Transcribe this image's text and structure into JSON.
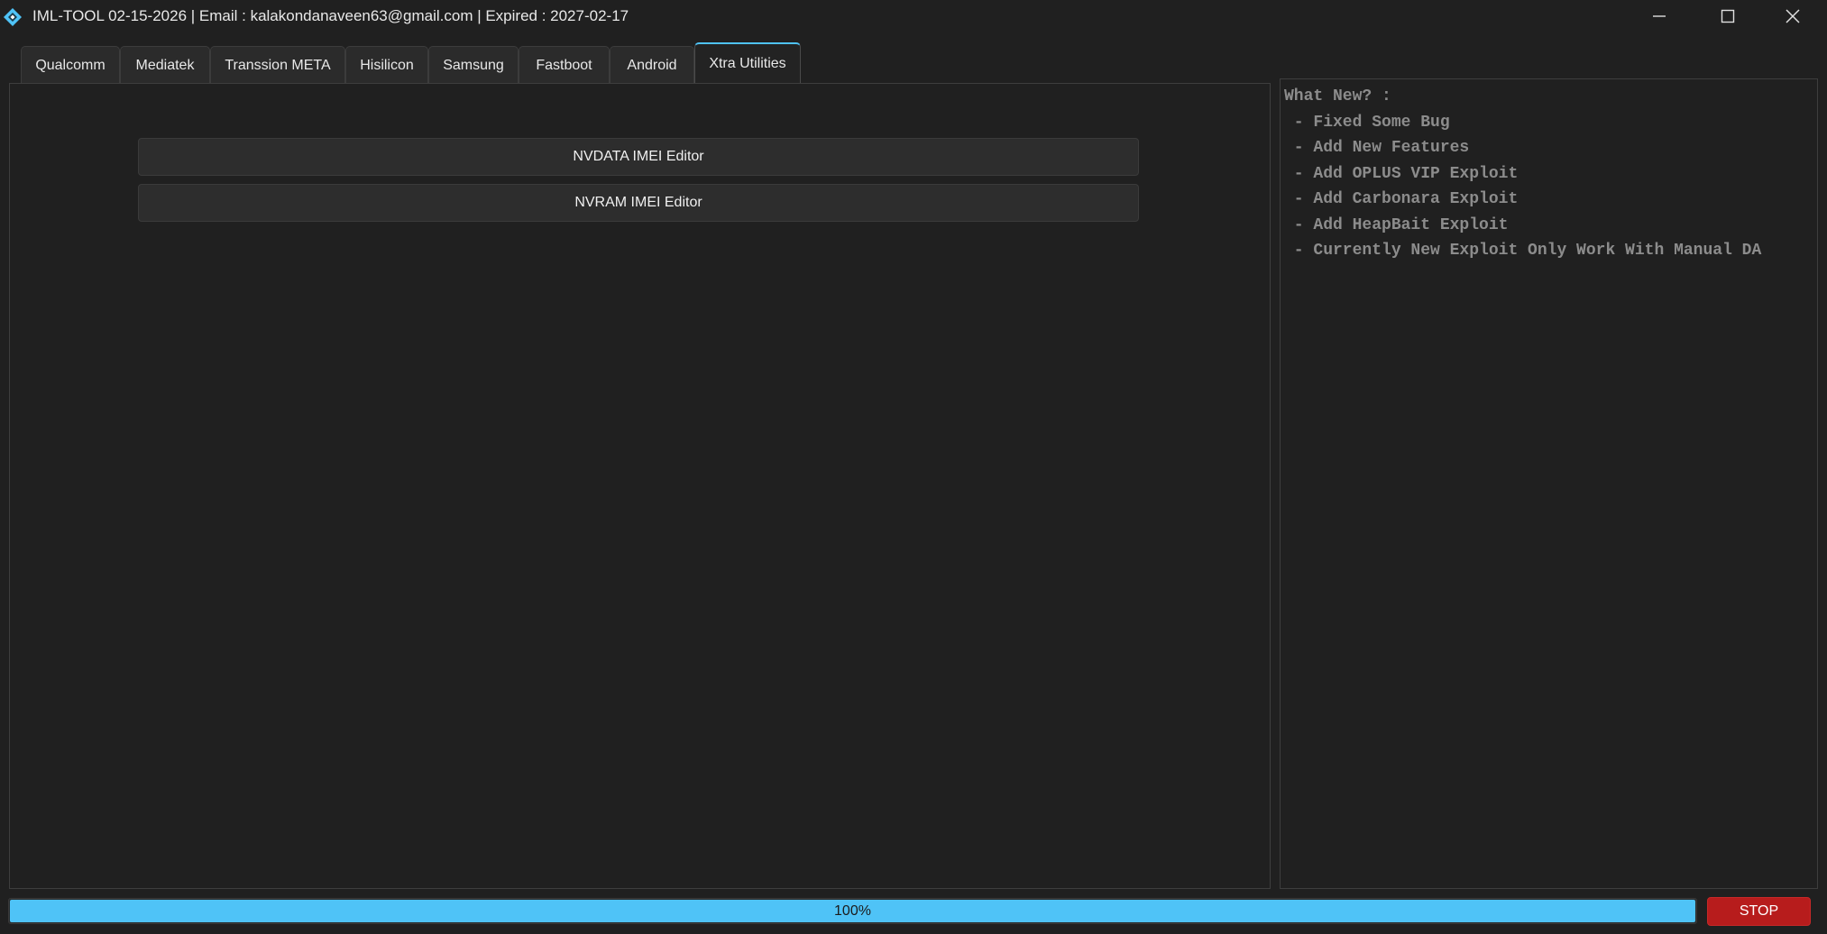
{
  "window": {
    "title": "IML-TOOL 02-15-2026 | Email : kalakondanaveen63@gmail.com | Expired : 2027-02-17",
    "icon": "diamond-app-icon",
    "controls": [
      "minimize-icon",
      "maximize-icon",
      "close-icon"
    ]
  },
  "tabs": [
    {
      "label": "Qualcomm",
      "active": false
    },
    {
      "label": "Mediatek",
      "active": false
    },
    {
      "label": "Transsion META",
      "active": false
    },
    {
      "label": "Hisilicon",
      "active": false
    },
    {
      "label": "Samsung",
      "active": false
    },
    {
      "label": "Fastboot",
      "active": false
    },
    {
      "label": "Android",
      "active": false
    },
    {
      "label": "Xtra Utilities",
      "active": true
    }
  ],
  "utilities": {
    "nvdata_label": "NVDATA IMEI Editor",
    "nvram_label": "NVRAM IMEI Editor"
  },
  "news": {
    "heading": "What New? :",
    "items": [
      " - Fixed Some Bug",
      " - Add New Features",
      " - Add OPLUS VIP Exploit",
      " - Add Carbonara Exploit",
      " - Add HeapBait Exploit",
      " - Currently New Exploit Only Work With Manual DA"
    ]
  },
  "status": {
    "progress_percent": 100,
    "progress_label": "100%",
    "stop_label": "STOP"
  },
  "colors": {
    "accent": "#4fc3f7",
    "background": "#202020",
    "stop": "#b71c1c",
    "news_text": "#8c8c8c"
  }
}
